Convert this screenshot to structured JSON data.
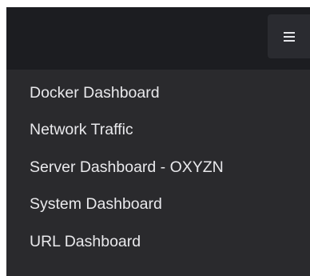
{
  "header": {
    "menu_icon": "hamburger-icon"
  },
  "dropdown": {
    "items": [
      {
        "label": "Docker Dashboard"
      },
      {
        "label": "Network Traffic"
      },
      {
        "label": "Server Dashboard - OXYZN"
      },
      {
        "label": "System Dashboard"
      },
      {
        "label": "URL Dashboard"
      }
    ]
  }
}
